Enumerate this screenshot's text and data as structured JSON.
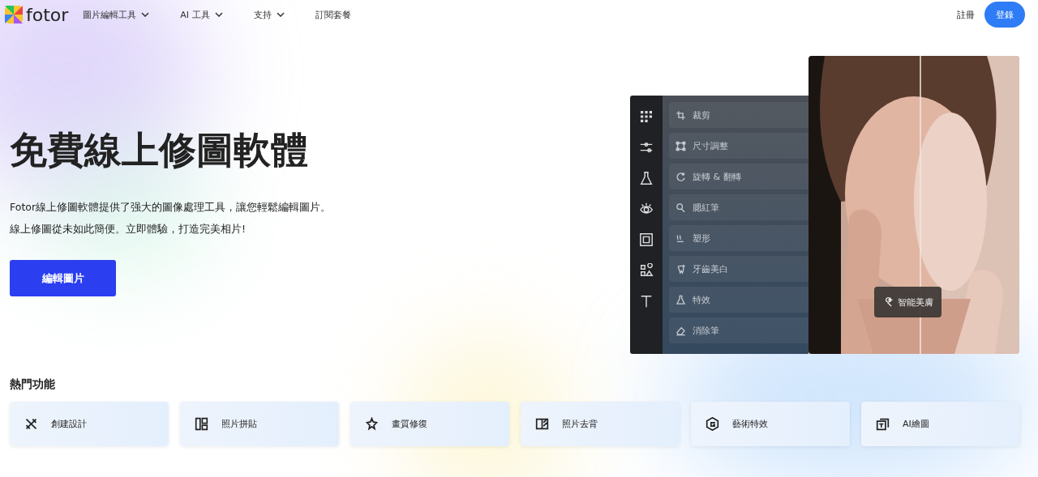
{
  "nav": {
    "logo": "fotor",
    "items": [
      {
        "label": "圖片編輯工具",
        "dropdown": true
      },
      {
        "label": "AI 工具",
        "dropdown": true
      },
      {
        "label": "支持",
        "dropdown": true
      },
      {
        "label": "訂閱套餐",
        "dropdown": false
      }
    ],
    "signup": "註冊",
    "login": "登錄"
  },
  "hero": {
    "title": "免費線上修圖軟體",
    "lines": [
      "Fotor線上修圖軟體提供了强大的圖像處理工具，讓您輕鬆編輯圖片。",
      "線上修圖從未如此簡便。立即體驗，打造完美相片!"
    ],
    "cta": "編輯圖片"
  },
  "editor": {
    "tools": [
      "裁剪",
      "尺寸調整",
      "旋轉 & 翻轉",
      "腮紅筆",
      "塑形",
      "牙齒美白",
      "特效",
      "消除筆"
    ],
    "badge": "智能美膚"
  },
  "popular": {
    "heading": "熱門功能",
    "cards": [
      "創建設計",
      "照片拼貼",
      "畫質修復",
      "照片去背",
      "藝術特效",
      "AI繪圖"
    ]
  }
}
